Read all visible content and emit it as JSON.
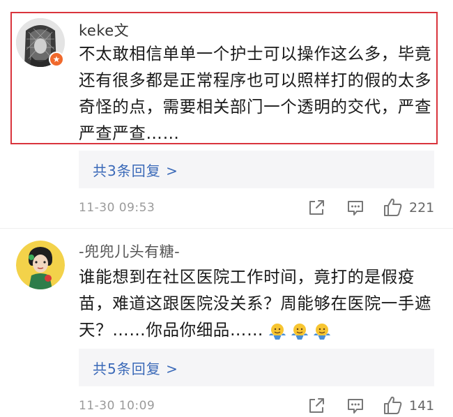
{
  "comments": [
    {
      "username": "keke文",
      "text": "不太敢相信单单一个护士可以操作这么多，毕竟还有很多都是正常程序也可以照样打的假的太多奇怪的点，需要相关部门一个透明的交代，严查严查严查……",
      "reply_link": "共3条回复 >",
      "time": "11-30 09:53",
      "likes": "221",
      "highlighted": true,
      "badge_icon": "verified-badge-icon"
    },
    {
      "username": "-兜兜儿头有糖-",
      "text": "谁能想到在社区医院工作时间，竟打的是假疫苗，难道这跟医院没关系？周能够在医院一手遮天？……你品你细品……",
      "reply_link": "共5条回复 >",
      "time": "11-30 10:09",
      "likes": "141",
      "emojis": [
        "shrug-emoji-icon",
        "shrug-emoji-icon",
        "shrug-emoji-icon"
      ]
    }
  ],
  "colors": {
    "highlight_border": "#d9343c",
    "link": "#3a69b8",
    "reply_bg": "#f5f5f7",
    "meta_text": "#9a9a9a"
  }
}
